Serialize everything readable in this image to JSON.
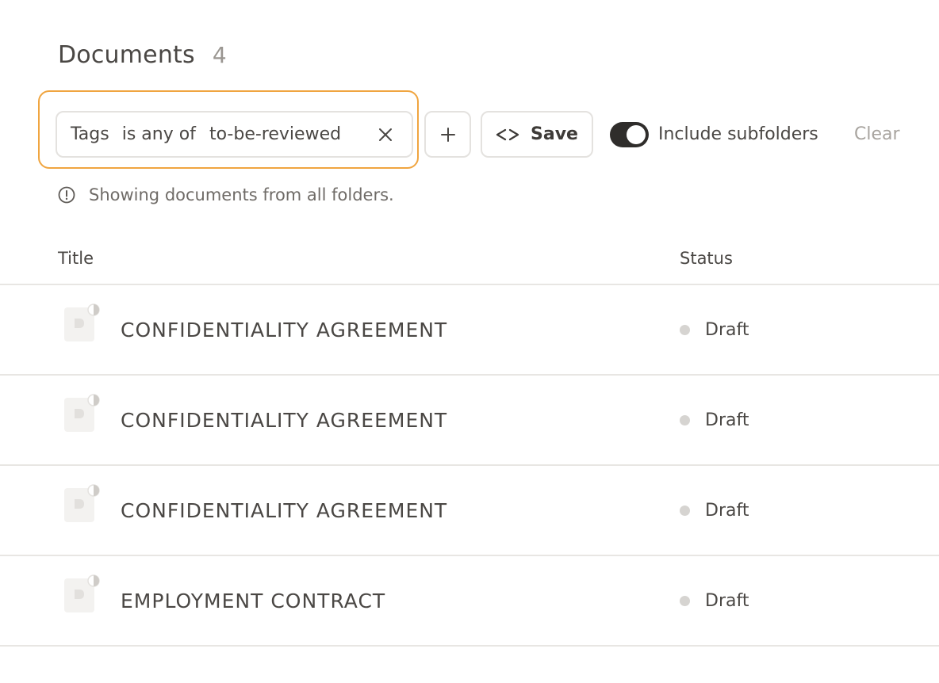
{
  "header": {
    "title": "Documents",
    "count": "4"
  },
  "filter": {
    "field": "Tags",
    "operator": "is any of",
    "value": "to-be-reviewed"
  },
  "toolbar": {
    "save_label": "Save",
    "toggle_label": "Include subfolders",
    "toggle_on": true,
    "clear_label": "Clear"
  },
  "info": {
    "message": "Showing documents from all folders."
  },
  "table": {
    "columns": [
      "Title",
      "Status"
    ],
    "rows": [
      {
        "title": "CONFIDENTIALITY AGREEMENT",
        "status": "Draft"
      },
      {
        "title": "CONFIDENTIALITY AGREEMENT",
        "status": "Draft"
      },
      {
        "title": "CONFIDENTIALITY AGREEMENT",
        "status": "Draft"
      },
      {
        "title": "EMPLOYMENT CONTRACT",
        "status": "Draft"
      }
    ]
  },
  "colors": {
    "focus_ring": "#f0a540",
    "toggle_on": "#2f2d2b",
    "status_draft": "#d6d4d1",
    "text": "#4a4744"
  },
  "icons": {
    "close": "close-icon",
    "add": "plus-icon",
    "save": "diamond-outline-icon",
    "info": "info-circle-icon",
    "document": "document-icon"
  }
}
